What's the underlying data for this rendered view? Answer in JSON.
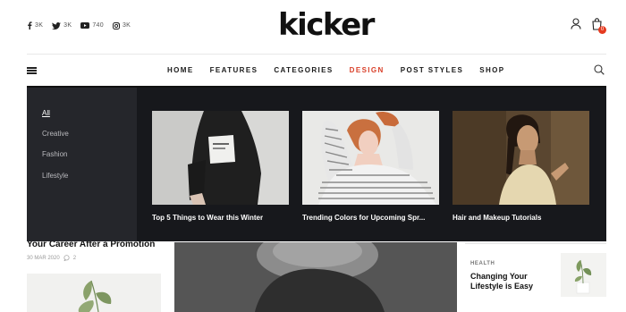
{
  "brand": {
    "logo": "kicker",
    "accent": "#d9402a"
  },
  "socials": [
    {
      "icon": "facebook-icon",
      "count": "3K"
    },
    {
      "icon": "twitter-icon",
      "count": "3K"
    },
    {
      "icon": "youtube-icon",
      "count": "740"
    },
    {
      "icon": "instagram-icon",
      "count": "3K"
    }
  ],
  "header": {
    "cart_count": "0"
  },
  "nav": {
    "items": [
      "HOME",
      "FEATURES",
      "CATEGORIES",
      "DESIGN",
      "POST STYLES",
      "SHOP"
    ],
    "active": "DESIGN"
  },
  "mega_menu": {
    "categories": [
      "All",
      "Creative",
      "Fashion",
      "Lifestyle"
    ],
    "active_category": "All",
    "cards": [
      {
        "title": "Top 5 Things to Wear this Winter"
      },
      {
        "title": "Trending Colors for Upcoming Spr..."
      },
      {
        "title": "Hair and Makeup Tutorials"
      }
    ]
  },
  "background": {
    "left_title": "Your Career After a Promotion",
    "left_date": "30 MAR 2020",
    "left_comments": "2",
    "side_category": "HEALTH",
    "side_title": "Changing Your Lifestyle is Easy"
  }
}
